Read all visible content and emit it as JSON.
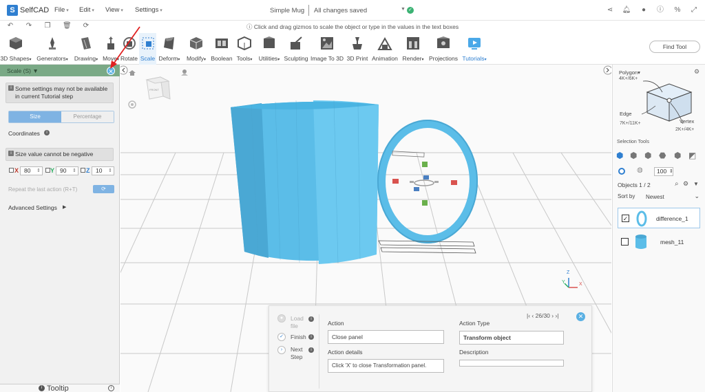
{
  "app": {
    "logo_text": "SelfCAD",
    "logo_mark": "S"
  },
  "menu": {
    "file": "File",
    "edit": "Edit",
    "view": "View",
    "settings": "Settings"
  },
  "project": {
    "name": "Simple Mug",
    "status": "All changes saved"
  },
  "hint": "Click and drag gizmos to scale the object or type in the values in the text boxes",
  "toolbar": {
    "items": [
      "3D Shapes",
      "Generators",
      "Drawing",
      "Move",
      "Rotate",
      "Scale",
      "Deform",
      "Modify",
      "Boolean",
      "Tools",
      "Utilities",
      "Sculpting",
      "Image To 3D",
      "3D Print",
      "Animation",
      "Render",
      "Projections",
      "Tutorials"
    ],
    "find_tool": "Find Tool"
  },
  "left_panel": {
    "title": "Scale (S)",
    "note1": "Some settings may not be available in current Tutorial step",
    "mode_size": "Size",
    "mode_percentage": "Percentage",
    "coordinates_label": "Coordinates",
    "note2": "Size value cannot be negative",
    "x_label": "X",
    "x_value": "80",
    "y_label": "Y",
    "y_value": "90",
    "z_label": "Z",
    "z_value": "10",
    "repeat_label": "Repeat the last action (R+T)",
    "advanced_settings": "Advanced Settings",
    "tooltip": "Tooltip"
  },
  "right_panel": {
    "polygon_label": "Polygon",
    "polygon_count": "4K+/6K+",
    "edge_label": "Edge",
    "edge_count": "7K+/11K+",
    "vertex_label": "Vertex",
    "vertex_count": "2K+/4K+",
    "selection_tools": "Selection Tools",
    "zoom_value": "100",
    "objects_count": "Objects 1 / 2",
    "sort_label": "Sort by",
    "sort_value": "Newest",
    "objects": [
      {
        "name": "difference_1",
        "checked": true
      },
      {
        "name": "mesh_11",
        "checked": false
      }
    ]
  },
  "tutorial": {
    "steps": [
      "Load file",
      "Finish",
      "Next Step"
    ],
    "action_label": "Action",
    "action_value": "Close panel",
    "action_details_label": "Action details",
    "action_details_value": "Click 'X' to close Transformation panel.",
    "action_type_label": "Action Type",
    "action_type_value": "Transform object",
    "description_label": "Description",
    "description_value": "",
    "progress": "26/30"
  },
  "viewcube": {
    "face_label": "FRONT"
  },
  "axes": {
    "x": "X",
    "y": "Y",
    "z": "Z"
  },
  "colors": {
    "accent": "#2f7fd0",
    "panel_header": "#7aa986",
    "model": "#5bc0eb",
    "close_button": "#5ab0e3",
    "annotation_arrow": "#e02020"
  }
}
